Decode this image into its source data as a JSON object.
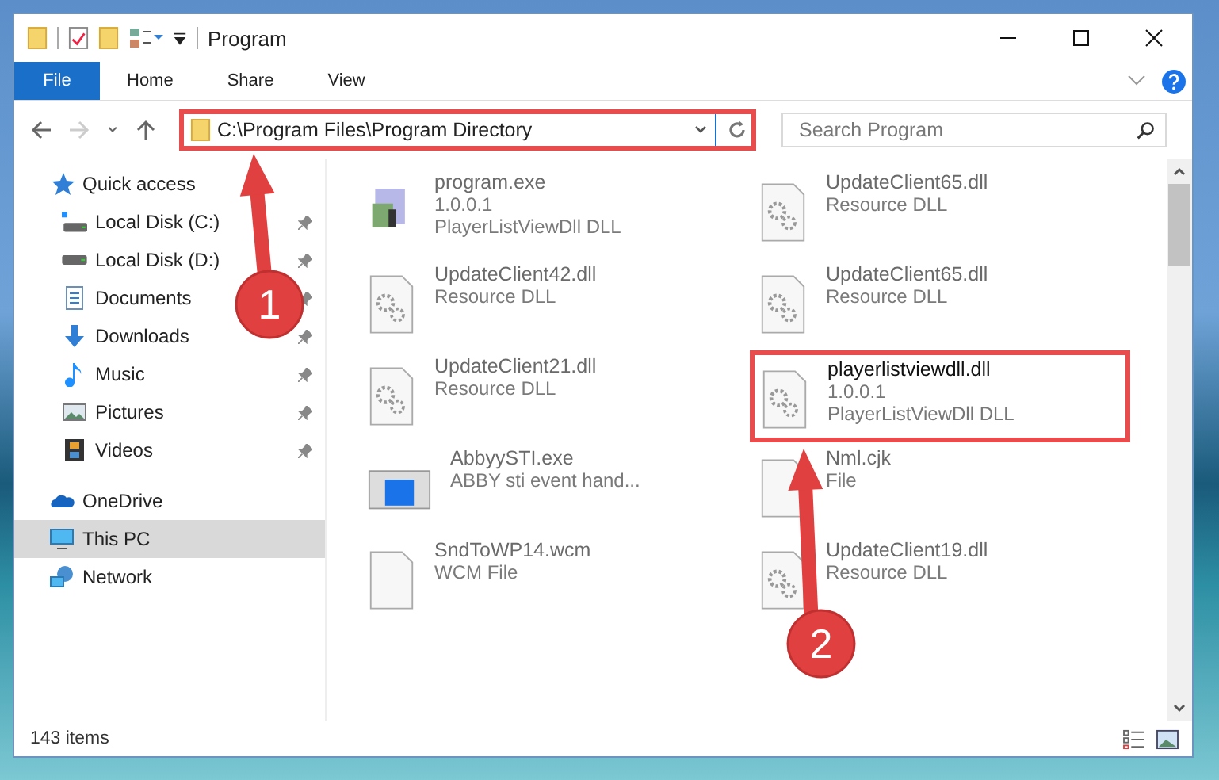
{
  "window": {
    "title": "Program"
  },
  "ribbon_tabs": [
    {
      "label": "File",
      "selected": true
    },
    {
      "label": "Home",
      "selected": false
    },
    {
      "label": "Share",
      "selected": false
    },
    {
      "label": "View",
      "selected": false
    }
  ],
  "address_bar": {
    "value": "C:\\Program Files\\Program Directory",
    "highlighted": true
  },
  "search": {
    "placeholder": "Search Program"
  },
  "sidebar": {
    "items": [
      {
        "label": "Quick access",
        "kind": "quick",
        "selected": false,
        "children": [
          {
            "label": "Local Disk (C:)",
            "kind": "sysdisk",
            "pinned": true,
            "selected": false
          },
          {
            "label": "Local Disk (D:)",
            "kind": "disk",
            "pinned": true,
            "selected": false
          },
          {
            "label": "Documents",
            "kind": "docs",
            "pinned": true,
            "selected": false
          },
          {
            "label": "Downloads",
            "kind": "download",
            "pinned": true,
            "selected": false
          },
          {
            "label": "Music",
            "kind": "music",
            "pinned": true,
            "selected": false
          },
          {
            "label": "Pictures",
            "kind": "pictures",
            "pinned": true,
            "selected": false
          },
          {
            "label": "Videos",
            "kind": "videos",
            "pinned": true,
            "selected": false
          }
        ]
      },
      {
        "label": "OneDrive",
        "kind": "cloud",
        "selected": false
      },
      {
        "label": "This PC",
        "kind": "pc",
        "selected": true
      },
      {
        "label": "Network",
        "kind": "network",
        "selected": false
      }
    ]
  },
  "files": [
    {
      "name": "program.exe",
      "lines": [
        "1.0.0.1",
        "PlayerListViewDll DLL"
      ],
      "kind": "exe",
      "blurred": true,
      "highlighted": false
    },
    {
      "name": "UpdateClient65.dll",
      "lines": [
        "Resource DLL"
      ],
      "kind": "dll",
      "blurred": true,
      "highlighted": false
    },
    {
      "name": "UpdateClient42.dll",
      "lines": [
        "Resource DLL"
      ],
      "kind": "dll",
      "blurred": true,
      "highlighted": false
    },
    {
      "name": "UpdateClient65.dll",
      "lines": [
        "Resource DLL"
      ],
      "kind": "dll",
      "blurred": true,
      "highlighted": false
    },
    {
      "name": "UpdateClient21.dll",
      "lines": [
        "Resource DLL"
      ],
      "kind": "dll",
      "blurred": true,
      "highlighted": false
    },
    {
      "name": "playerlistviewdll.dll",
      "lines": [
        "1.0.0.1",
        "PlayerListViewDll DLL"
      ],
      "kind": "dll",
      "blurred": false,
      "highlighted": true
    },
    {
      "name": "AbbyySTI.exe",
      "lines": [
        "ABBY sti event hand..."
      ],
      "kind": "app",
      "blurred": true,
      "highlighted": false
    },
    {
      "name": "Nml.cjk",
      "lines": [
        "File"
      ],
      "kind": "file",
      "blurred": true,
      "highlighted": false
    },
    {
      "name": "SndToWP14.wcm",
      "lines": [
        "WCM File"
      ],
      "kind": "file",
      "blurred": true,
      "highlighted": false
    },
    {
      "name": "UpdateClient19.dll",
      "lines": [
        "Resource DLL"
      ],
      "kind": "dll",
      "blurred": true,
      "highlighted": false
    }
  ],
  "status_bar": {
    "count": "143 items"
  },
  "annotations": [
    {
      "label": "1"
    },
    {
      "label": "2"
    }
  ]
}
